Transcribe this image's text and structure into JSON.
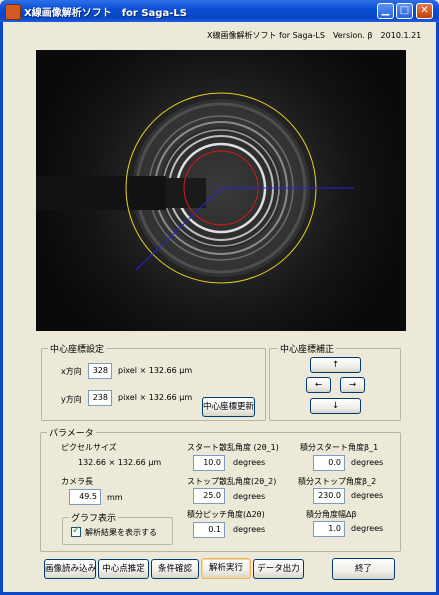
{
  "window": {
    "title": "X線画像解析ソフト　for Saga-LS"
  },
  "header": {
    "version_text": "X線画像解析ソフト for Saga-LS　Version. β　2010.1.21"
  },
  "center_settings": {
    "legend": "中心座標設定",
    "x_label": "x方向",
    "x_value": "328",
    "y_label": "y方向",
    "y_value": "238",
    "unit_text": "pixel × 132.66 μm",
    "update_button": "中心座標更新"
  },
  "center_correction": {
    "legend": "中心座標補正",
    "up": "↑",
    "left": "←",
    "right": "→",
    "down": "↓"
  },
  "params": {
    "legend": "パラメータ",
    "pixel_size_label": "ピクセルサイズ",
    "pixel_size_value": "132.66 × 132.66 μm",
    "camera_label": "カメラ長",
    "camera_value": "49.5",
    "camera_unit": "mm",
    "start_angle_label": "スタート散乱角度 (2θ_1)",
    "start_angle_value": "10.0",
    "stop_angle_label": "ストップ散乱角度(2θ_2)",
    "stop_angle_value": "25.0",
    "pitch_label": "積分ピッチ角度(Δ2θ)",
    "pitch_value": "0.1",
    "int_start_label": "積分スタート角度β_1",
    "int_start_value": "0.0",
    "int_stop_label": "積分ストップ角度β_2",
    "int_stop_value": "230.0",
    "int_width_label": "積分角度幅Δβ",
    "int_width_value": "1.0",
    "degrees": "degrees",
    "graph_legend": "グラフ表示",
    "graph_checkbox": "解析結果を表示する"
  },
  "buttons": {
    "load": "画像読み込み",
    "center": "中心点推定",
    "confirm": "条件確認",
    "run": "解析実行",
    "output": "データ出力",
    "exit": "終了"
  },
  "colors": {
    "title_bar": "#0a4fd6",
    "yellow_ring": "#e6d21e",
    "red_ring": "#d11a1a",
    "blue_line": "#2424d8"
  }
}
